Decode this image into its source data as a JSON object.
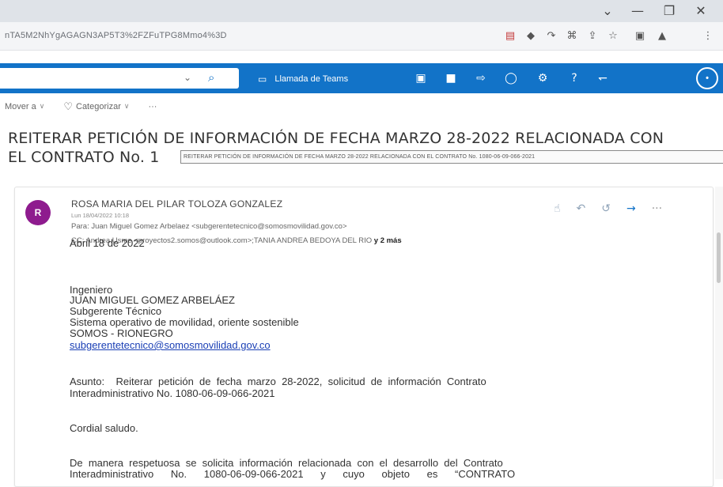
{
  "browser": {
    "url": "nTA5M2NhYgAGAGN3AP5T3%2FZFuTPG8Mmo4%3D",
    "window_controls": [
      "⌄",
      "—",
      "❐",
      "✕"
    ],
    "extension_icons": [
      "▤",
      "◆",
      "↷",
      "⌘",
      "⇪",
      "☆",
      "▣",
      "▲",
      "⋮"
    ]
  },
  "appbar": {
    "teams_label": "Llamada de Teams",
    "icons": [
      "▣",
      "■",
      "⇨",
      "◯",
      "⚙",
      "?",
      "↽"
    ],
    "account_initial": "•"
  },
  "commandbar": {
    "move_label": "Mover a",
    "categorize_label": "Categorizar",
    "more_label": "···"
  },
  "email": {
    "subject_line1": "REITERAR PETICIÓN DE INFORMACIÓN DE FECHA MARZO 28-2022 RELACIONADA CON",
    "subject_line2": "EL CONTRATO No. 1",
    "subject_tooltip": "REITERAR PETICIÓN DE INFORMACIÓN DE FECHA MARZO 28-2022 RELACIONADA CON EL CONTRATO No. 1080-06-09-066-2021",
    "sender_initial": "R",
    "sender_name": "ROSA MARIA DEL PILAR TOLOZA GONZALEZ",
    "sent_date": "Lun 18/04/2022 10:18",
    "to": "Para: Juan Miguel Gomez Arbelaez <subgerentetecnico@somosmovilidad.gov.co>",
    "cc": "CC: Andrea Usme <proyectos2.somos@outlook.com>;TANIA ANDREA BEDOYA DEL RIO",
    "cc_more": "y 2 más",
    "body": {
      "date_line": "Abril 18 de 2022",
      "greeting_title": "Ingeniero",
      "recipient_name": "JUAN MIGUEL GOMEZ ARBELÁEZ",
      "recipient_role": "Subgerente Técnico",
      "recipient_org": "Sistema operativo de movilidad, oriente sostenible",
      "recipient_company": "SOMOS - RIONEGRO",
      "recipient_email": "subgerentetecnico@somosmovilidad.gov.co",
      "subject_para_line1": "Asunto:    Reiterar  petición  de  fecha  marzo  28-2022,  solicitud  de  información  Contrato",
      "subject_para_line2": "Interadministrativo No. 1080-06-09-066-2021",
      "salutation": "Cordial saludo.",
      "para_line1": "De  manera  respetuosa  se  solicita  información  relacionada  con  el  desarrollo  del  Contrato",
      "para_line2": "Interadministrativo      No.      1080-06-09-066-2021      y      cuyo      objeto      es      “CONTRATO"
    }
  }
}
